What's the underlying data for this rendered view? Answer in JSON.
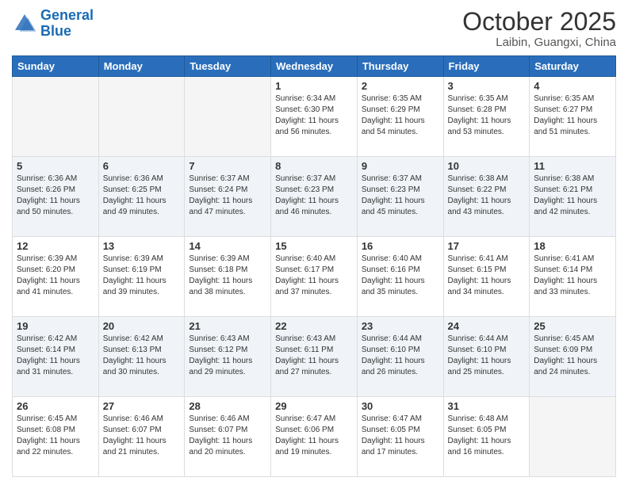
{
  "header": {
    "logo_general": "General",
    "logo_blue": "Blue",
    "month": "October 2025",
    "location": "Laibin, Guangxi, China"
  },
  "days_of_week": [
    "Sunday",
    "Monday",
    "Tuesday",
    "Wednesday",
    "Thursday",
    "Friday",
    "Saturday"
  ],
  "weeks": [
    [
      {
        "day": "",
        "info": ""
      },
      {
        "day": "",
        "info": ""
      },
      {
        "day": "",
        "info": ""
      },
      {
        "day": "1",
        "info": "Sunrise: 6:34 AM\nSunset: 6:30 PM\nDaylight: 11 hours\nand 56 minutes."
      },
      {
        "day": "2",
        "info": "Sunrise: 6:35 AM\nSunset: 6:29 PM\nDaylight: 11 hours\nand 54 minutes."
      },
      {
        "day": "3",
        "info": "Sunrise: 6:35 AM\nSunset: 6:28 PM\nDaylight: 11 hours\nand 53 minutes."
      },
      {
        "day": "4",
        "info": "Sunrise: 6:35 AM\nSunset: 6:27 PM\nDaylight: 11 hours\nand 51 minutes."
      }
    ],
    [
      {
        "day": "5",
        "info": "Sunrise: 6:36 AM\nSunset: 6:26 PM\nDaylight: 11 hours\nand 50 minutes."
      },
      {
        "day": "6",
        "info": "Sunrise: 6:36 AM\nSunset: 6:25 PM\nDaylight: 11 hours\nand 49 minutes."
      },
      {
        "day": "7",
        "info": "Sunrise: 6:37 AM\nSunset: 6:24 PM\nDaylight: 11 hours\nand 47 minutes."
      },
      {
        "day": "8",
        "info": "Sunrise: 6:37 AM\nSunset: 6:23 PM\nDaylight: 11 hours\nand 46 minutes."
      },
      {
        "day": "9",
        "info": "Sunrise: 6:37 AM\nSunset: 6:23 PM\nDaylight: 11 hours\nand 45 minutes."
      },
      {
        "day": "10",
        "info": "Sunrise: 6:38 AM\nSunset: 6:22 PM\nDaylight: 11 hours\nand 43 minutes."
      },
      {
        "day": "11",
        "info": "Sunrise: 6:38 AM\nSunset: 6:21 PM\nDaylight: 11 hours\nand 42 minutes."
      }
    ],
    [
      {
        "day": "12",
        "info": "Sunrise: 6:39 AM\nSunset: 6:20 PM\nDaylight: 11 hours\nand 41 minutes."
      },
      {
        "day": "13",
        "info": "Sunrise: 6:39 AM\nSunset: 6:19 PM\nDaylight: 11 hours\nand 39 minutes."
      },
      {
        "day": "14",
        "info": "Sunrise: 6:39 AM\nSunset: 6:18 PM\nDaylight: 11 hours\nand 38 minutes."
      },
      {
        "day": "15",
        "info": "Sunrise: 6:40 AM\nSunset: 6:17 PM\nDaylight: 11 hours\nand 37 minutes."
      },
      {
        "day": "16",
        "info": "Sunrise: 6:40 AM\nSunset: 6:16 PM\nDaylight: 11 hours\nand 35 minutes."
      },
      {
        "day": "17",
        "info": "Sunrise: 6:41 AM\nSunset: 6:15 PM\nDaylight: 11 hours\nand 34 minutes."
      },
      {
        "day": "18",
        "info": "Sunrise: 6:41 AM\nSunset: 6:14 PM\nDaylight: 11 hours\nand 33 minutes."
      }
    ],
    [
      {
        "day": "19",
        "info": "Sunrise: 6:42 AM\nSunset: 6:14 PM\nDaylight: 11 hours\nand 31 minutes."
      },
      {
        "day": "20",
        "info": "Sunrise: 6:42 AM\nSunset: 6:13 PM\nDaylight: 11 hours\nand 30 minutes."
      },
      {
        "day": "21",
        "info": "Sunrise: 6:43 AM\nSunset: 6:12 PM\nDaylight: 11 hours\nand 29 minutes."
      },
      {
        "day": "22",
        "info": "Sunrise: 6:43 AM\nSunset: 6:11 PM\nDaylight: 11 hours\nand 27 minutes."
      },
      {
        "day": "23",
        "info": "Sunrise: 6:44 AM\nSunset: 6:10 PM\nDaylight: 11 hours\nand 26 minutes."
      },
      {
        "day": "24",
        "info": "Sunrise: 6:44 AM\nSunset: 6:10 PM\nDaylight: 11 hours\nand 25 minutes."
      },
      {
        "day": "25",
        "info": "Sunrise: 6:45 AM\nSunset: 6:09 PM\nDaylight: 11 hours\nand 24 minutes."
      }
    ],
    [
      {
        "day": "26",
        "info": "Sunrise: 6:45 AM\nSunset: 6:08 PM\nDaylight: 11 hours\nand 22 minutes."
      },
      {
        "day": "27",
        "info": "Sunrise: 6:46 AM\nSunset: 6:07 PM\nDaylight: 11 hours\nand 21 minutes."
      },
      {
        "day": "28",
        "info": "Sunrise: 6:46 AM\nSunset: 6:07 PM\nDaylight: 11 hours\nand 20 minutes."
      },
      {
        "day": "29",
        "info": "Sunrise: 6:47 AM\nSunset: 6:06 PM\nDaylight: 11 hours\nand 19 minutes."
      },
      {
        "day": "30",
        "info": "Sunrise: 6:47 AM\nSunset: 6:05 PM\nDaylight: 11 hours\nand 17 minutes."
      },
      {
        "day": "31",
        "info": "Sunrise: 6:48 AM\nSunset: 6:05 PM\nDaylight: 11 hours\nand 16 minutes."
      },
      {
        "day": "",
        "info": ""
      }
    ]
  ]
}
